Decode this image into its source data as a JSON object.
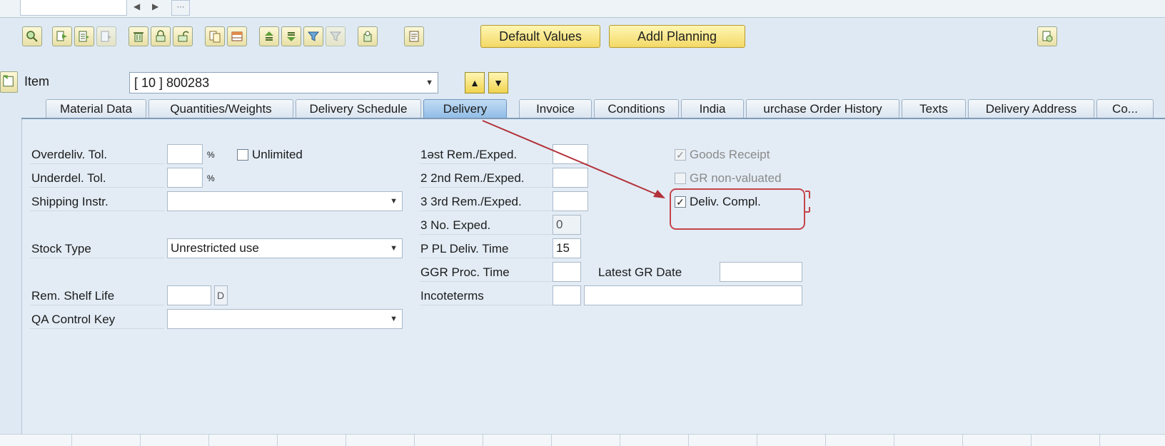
{
  "toolbar": {
    "buttons": [
      {
        "name": "zoom-detail-icon"
      },
      {
        "name": "copy-right-icon"
      },
      {
        "name": "edit-list-icon"
      },
      {
        "name": "export-icon"
      },
      {
        "name": "trash-icon"
      },
      {
        "name": "lock-icon"
      },
      {
        "name": "unlock-icon"
      },
      {
        "name": "document-copy-icon"
      },
      {
        "name": "calendar-table-icon"
      },
      {
        "name": "sort-ascending-icon"
      },
      {
        "name": "sort-descending-icon"
      },
      {
        "name": "filter-icon"
      },
      {
        "name": "filter-clear-icon"
      },
      {
        "name": "pin-icon"
      },
      {
        "name": "notes-icon"
      }
    ],
    "default_values_label": "Default Values",
    "addl_planning_label": "Addl Planning",
    "right_icon": "document-settings-icon"
  },
  "item": {
    "label": "Item",
    "selected": "[ 10 ] 800283"
  },
  "tabs": [
    {
      "label": "Material Data"
    },
    {
      "label": "Quantities/Weights"
    },
    {
      "label": "Delivery Schedule"
    },
    {
      "label": "Delivery",
      "active": true
    },
    {
      "label": "Invoice"
    },
    {
      "label": "Conditions"
    },
    {
      "label": "India"
    },
    {
      "label": "urchase Order History"
    },
    {
      "label": "Texts"
    },
    {
      "label": "Delivery Address"
    },
    {
      "label": "Co..."
    }
  ],
  "form": {
    "overdeliv_label": "Overdeliv. Tol.",
    "overdeliv_value": "",
    "overdeliv_unit": "%",
    "unlimited_label": "Unlimited",
    "underdel_label": "Underdel. Tol.",
    "underdel_value": "",
    "underdel_unit": "%",
    "shipping_label": "Shipping Instr.",
    "shipping_value": "",
    "stock_type_label": "Stock Type",
    "stock_type_value": "Unrestricted use",
    "shelf_life_label": "Rem. Shelf Life",
    "shelf_life_value": "",
    "shelf_life_unit": "D",
    "qa_label": "QA Control Key",
    "qa_value": "",
    "rem1_label": "1əst Rem./Exped.",
    "rem1_value": "",
    "rem2_label": "2 2nd Rem./Exped.",
    "rem2_value": "",
    "rem3_label": "3 3rd Rem./Exped.",
    "rem3_value": "",
    "no_exped_label": "3 No. Exped.",
    "no_exped_value": "0",
    "pl_deliv_label": "P PL Deliv. Time",
    "pl_deliv_value": "15",
    "gr_proc_label": "GGR Proc. Time",
    "gr_proc_value": "",
    "latest_gr_label": "Latest GR Date",
    "latest_gr_value": "",
    "incoterms_label": "Incoteterms",
    "incoterms_value1": "",
    "incoterms_value2": "",
    "goods_receipt_label": "Goods Receipt",
    "goods_receipt_checked": "✓",
    "gr_nonval_label": "GR non-valuated",
    "deliv_compl_label": "Deliv. Compl.",
    "deliv_compl_checked": "✓"
  }
}
